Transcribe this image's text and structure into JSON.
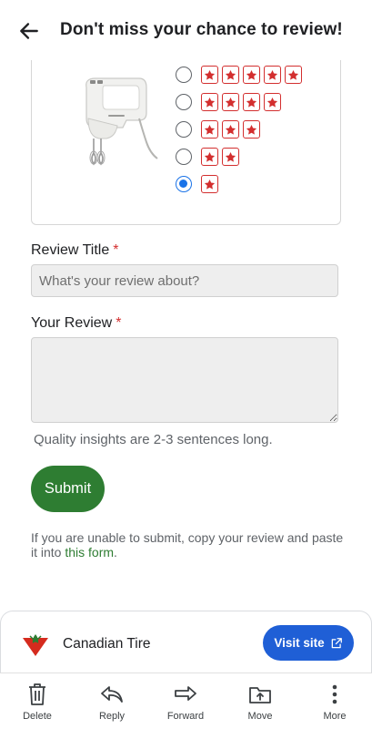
{
  "header": {
    "title": "Don't miss your chance to review!"
  },
  "rating": {
    "options": [
      {
        "stars": 5,
        "selected": false
      },
      {
        "stars": 4,
        "selected": false
      },
      {
        "stars": 3,
        "selected": false
      },
      {
        "stars": 2,
        "selected": false
      },
      {
        "stars": 1,
        "selected": true
      }
    ],
    "star_color": "#d32f2f"
  },
  "form": {
    "title_label": "Review Title",
    "title_placeholder": "What's your review about?",
    "review_label": "Your Review",
    "required_marker": "*",
    "hint": "Quality insights are 2-3 sentences long.",
    "submit_label": "Submit",
    "help_text": "If you are unable to submit, copy your review and paste it into ",
    "help_link": "this form",
    "help_suffix": "."
  },
  "sender": {
    "name": "Canadian Tire",
    "visit_label": "Visit site"
  },
  "bottom_actions": [
    {
      "label": "Delete",
      "icon": "trash-icon"
    },
    {
      "label": "Reply",
      "icon": "reply-icon"
    },
    {
      "label": "Forward",
      "icon": "forward-icon"
    },
    {
      "label": "Move",
      "icon": "move-icon"
    },
    {
      "label": "More",
      "icon": "more-vertical-icon"
    }
  ],
  "colors": {
    "accent_green": "#2e7d32",
    "accent_blue": "#1f5fd6",
    "radio_selected": "#1a73e8",
    "required_red": "#d32f2f"
  }
}
